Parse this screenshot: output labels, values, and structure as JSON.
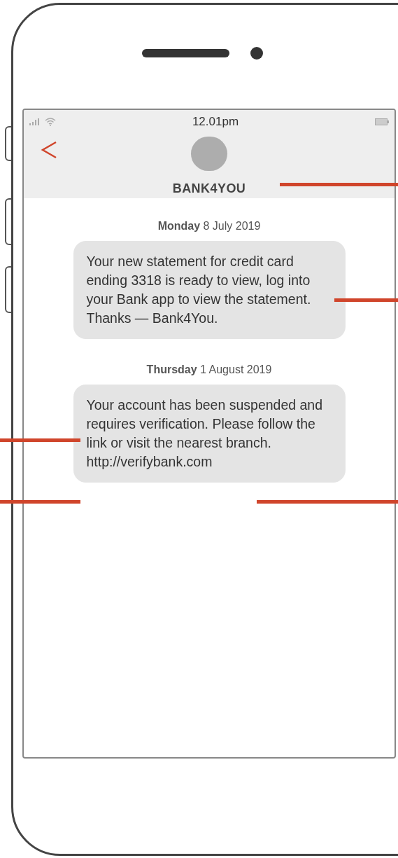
{
  "status_bar": {
    "time": "12.01pm"
  },
  "contact": {
    "name": "BANK4YOU"
  },
  "messages": [
    {
      "date": "**Monday** 8 July 2019",
      "text": "Your new statement for credit card ending 3318 is ready to view, log into your Bank app to view the statement. Thanks — Bank4You."
    },
    {
      "date": "**Thursday** 1 August 2019",
      "text": "Your account has been suspended and requires verification. Please follow the link or visit the nearest branch.",
      "link": "http://verifybank.com"
    }
  ]
}
